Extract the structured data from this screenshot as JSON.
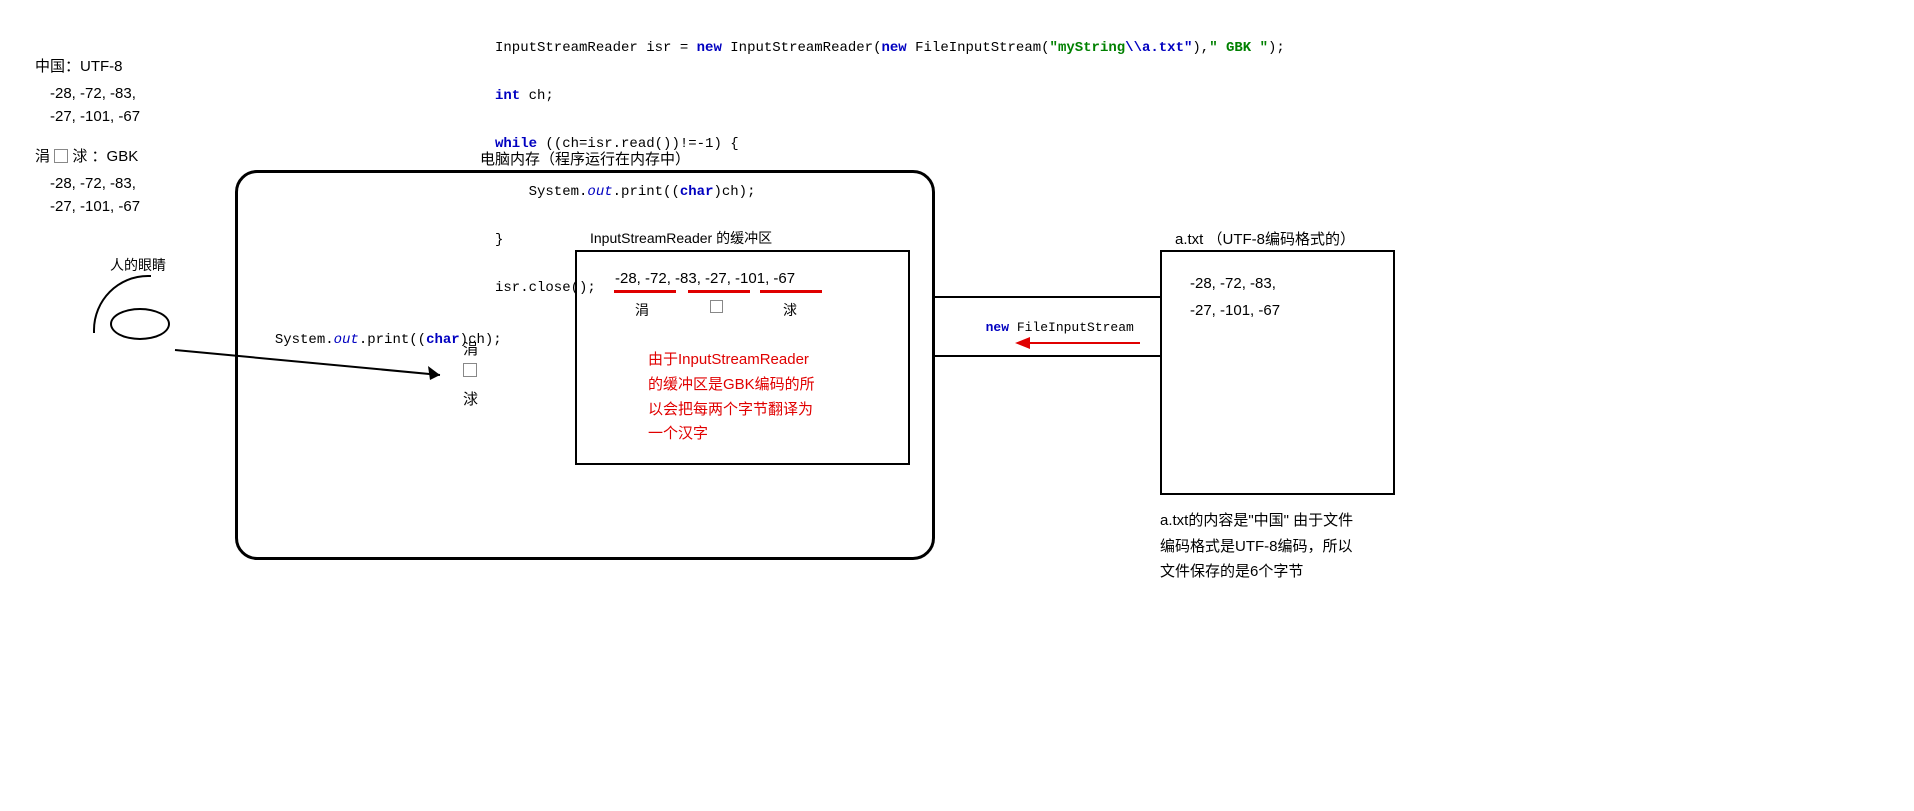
{
  "code": {
    "line1_a": "InputStreamReader isr = ",
    "line1_new1": "new",
    "line1_b": " InputStreamReader(",
    "line1_new2": "new",
    "line1_c": " FileInputStream(",
    "line1_str1": "\"myString",
    "line1_str2": "\\\\a.txt\"",
    "line1_d": "),",
    "line1_str3": "\" GBK \"",
    "line1_e": ");",
    "line2_a": "int",
    "line2_b": " ch;",
    "line3_a": "while",
    "line3_b": " ((ch=isr.read())!=-1) {",
    "line4_a": "    System.",
    "line4_out": "out",
    "line4_b": ".print((",
    "line4_char": "char",
    "line4_c": ")ch);",
    "line5": "}",
    "line6": "isr.close();"
  },
  "left": {
    "title": "中国：UTF-8",
    "bytes1a": "-28, -72, -83,",
    "bytes1b": "-27, -101, -67",
    "gbk_label_a": "涓",
    "gbk_label_b": "浗  ：GBK",
    "bytes2a": "-28, -72, -83,",
    "bytes2b": "-27, -101, -67",
    "eye_label": "人的眼睛"
  },
  "memory": {
    "title": "电脑内存（程序运行在内存中）",
    "print_a": "System.",
    "print_out": "out",
    "print_b": ".print((",
    "print_char": "char",
    "print_c": ")ch);",
    "char1": "涓",
    "char2": "",
    "char3": "浗"
  },
  "buffer": {
    "title": "InputStreamReader 的缓冲区",
    "bytes": "-28, -72, -83,  -27, -101, -67",
    "g1": "涓",
    "g2": "",
    "g3": "浗",
    "explain1": "由于InputStreamReader",
    "explain2": "的缓冲区是GBK编码的所",
    "explain3": "以会把每两个字节翻译为",
    "explain4": "一个汉字"
  },
  "stream_label_new": "new",
  "stream_label_rest": " FileInputStream",
  "file": {
    "title": "a.txt （UTF-8编码格式的）",
    "bytes1": "-28, -72, -83,",
    "bytes2": "-27, -101, -67",
    "note1": "a.txt的内容是\"中国\"   由于文件",
    "note2": "编码格式是UTF-8编码，所以",
    "note3": "文件保存的是6个字节"
  }
}
